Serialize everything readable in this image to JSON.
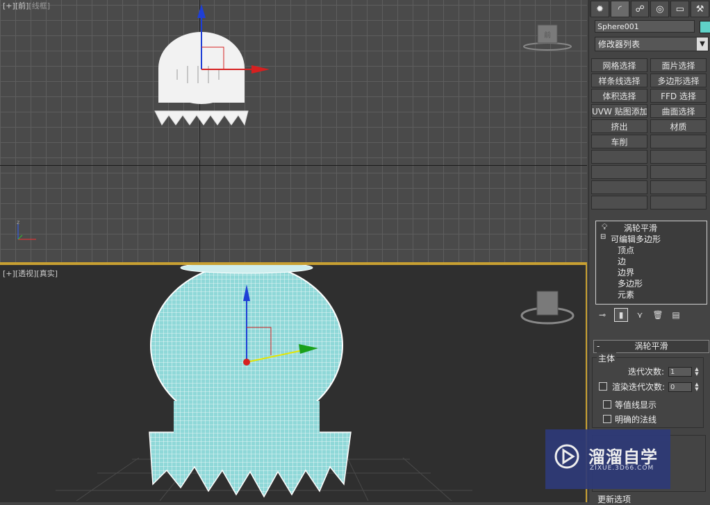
{
  "viewports": {
    "front": {
      "plus": "[+]",
      "view": "[前]",
      "mode": "[线框]"
    },
    "perspective": {
      "plus": "[+]",
      "view": "[透视]",
      "mode": "[真实]"
    }
  },
  "command_panel": {
    "tabs": [
      "create-icon",
      "modify-icon",
      "hierarchy-icon",
      "motion-icon",
      "display-icon",
      "utilities-icon"
    ],
    "object_name": "Sphere001",
    "object_color": "#5fd2c8",
    "modifier_list": "修改器列表",
    "modifier_buttons": [
      "网格选择",
      "面片选择",
      "样条线选择",
      "多边形选择",
      "体积选择",
      "FFD 选择",
      "UVW 贴图添加",
      "曲面选择",
      "挤出",
      "材质",
      "车削",
      "",
      "",
      "",
      "",
      "",
      "",
      "",
      "",
      ""
    ],
    "stack": {
      "top_modifier": "涡轮平滑",
      "base_object": "可编辑多边形",
      "sub_objects": [
        "顶点",
        "边",
        "边界",
        "多边形",
        "元素"
      ]
    },
    "rollout": {
      "title": "涡轮平滑",
      "toggle": "-",
      "group_main": "主体",
      "iterations_label": "迭代次数:",
      "iterations_value": "1",
      "render_iters_label": "渲染迭代次数:",
      "render_iters_value": "0",
      "isoline_label": "等值线显示",
      "explicit_normals_label": "明确的法线",
      "update_group": "更新选项"
    }
  },
  "watermark": {
    "title": "溜溜自学",
    "url": "ZIXUE.3D66.COM"
  }
}
